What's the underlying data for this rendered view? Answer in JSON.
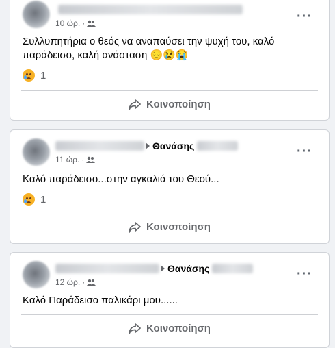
{
  "posts": [
    {
      "timestamp": "10 ώρ.",
      "text_line1": "Συλλυπητήρια ο θεός να αναπαύσει την ψυχή του, καλό",
      "text_line2": "παράδεισο, καλή ανάσταση 😔😢😭",
      "reaction_count": "1",
      "share_label": "Κοινοποίηση"
    },
    {
      "recipient": "Θανάσης",
      "timestamp": "11 ώρ.",
      "text": "Καλό παράδεισο...στην αγκαλιά του Θεού...",
      "reaction_count": "1",
      "share_label": "Κοινοποίηση"
    },
    {
      "recipient": "Θανάσης",
      "timestamp": "12 ώρ.",
      "text": "Καλό Παράδεισο παλικάρι μου......",
      "share_label": "Κοινοποίηση"
    }
  ],
  "icons": {
    "audience": "friends-icon",
    "share": "share-arrow-icon",
    "more": "more-options-icon",
    "reaction": "sad-emoji-icon"
  },
  "colors": {
    "text": "#050505",
    "secondary": "#65676b",
    "divider": "#ced0d4",
    "background": "#f0f2f5"
  }
}
